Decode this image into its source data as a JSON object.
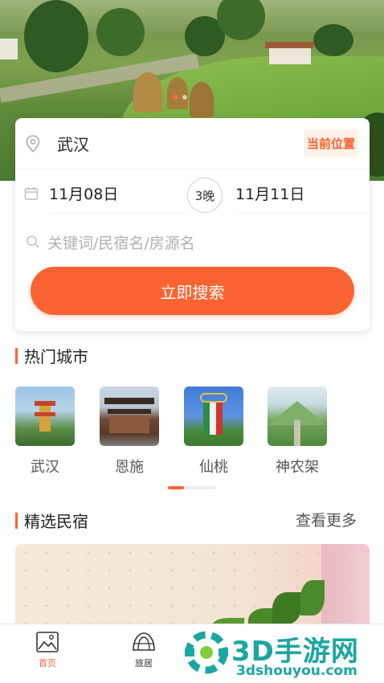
{
  "hero": {
    "dots": 2,
    "active_dot": 0
  },
  "search": {
    "city": "武汉",
    "locate_label": "当前位置",
    "checkin": "11月08日",
    "checkout": "11月11日",
    "nights": "3晚",
    "keyword_placeholder": "关键词/民宿名/房源名",
    "submit_label": "立即搜索"
  },
  "hot_cities": {
    "title": "热门城市",
    "items": [
      {
        "name": "武汉"
      },
      {
        "name": "恩施"
      },
      {
        "name": "仙桃"
      },
      {
        "name": "神农架"
      }
    ]
  },
  "featured": {
    "title": "精选民宿",
    "more_label": "查看更多"
  },
  "tabbar": {
    "items": [
      {
        "label": "首页",
        "icon": "picture-icon",
        "active": true
      },
      {
        "label": "旅居",
        "icon": "tent-icon",
        "active": false
      }
    ]
  },
  "watermark": {
    "brand": "3D手游网",
    "url": "3dshouyou.com"
  },
  "colors": {
    "accent": "#fb6432",
    "watermark": "#1aa6a1"
  }
}
